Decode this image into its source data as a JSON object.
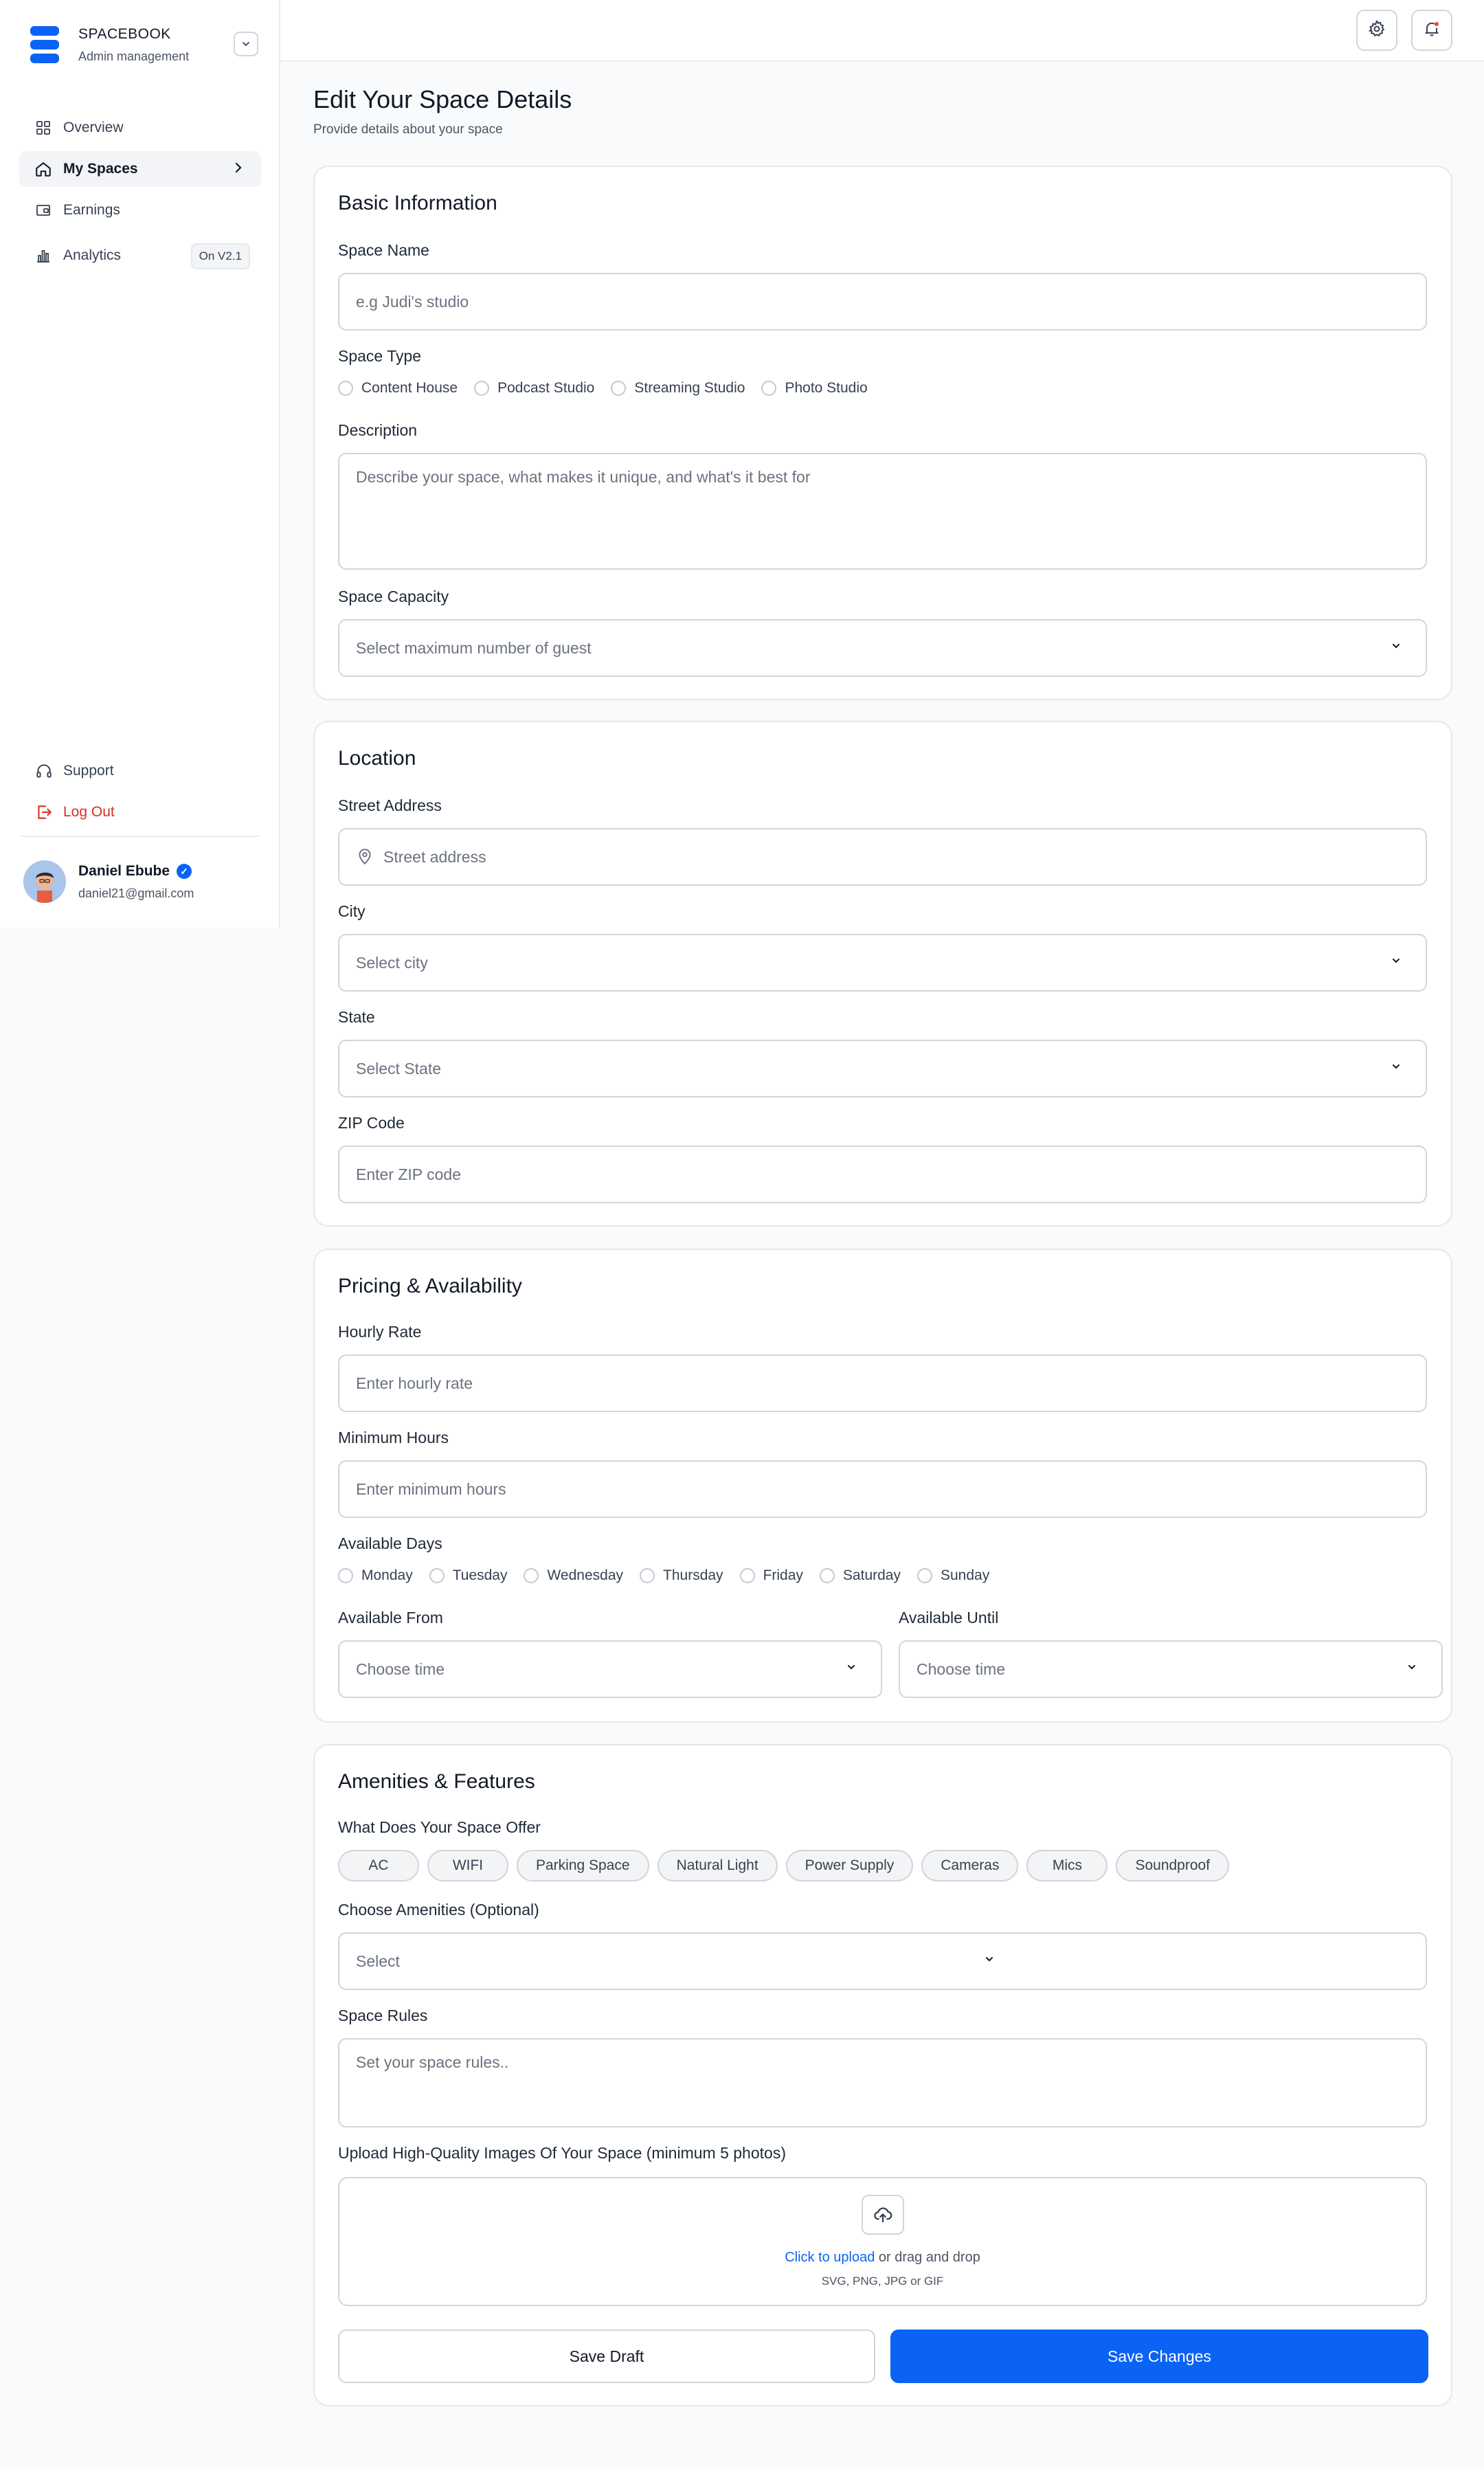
{
  "sidebar": {
    "brand_title": "SPACEBOOK",
    "brand_subtitle": "Admin management",
    "nav": [
      {
        "label": "Overview",
        "icon": "grid-icon"
      },
      {
        "label": "My Spaces",
        "icon": "home-icon",
        "active": true
      },
      {
        "label": "Earnings",
        "icon": "wallet-icon"
      },
      {
        "label": "Analytics",
        "icon": "bar-chart-icon",
        "badge": "On V2.1"
      }
    ],
    "support_label": "Support",
    "logout_label": "Log Out",
    "user": {
      "name": "Daniel Ebube",
      "email": "daniel21@gmail.com"
    }
  },
  "page": {
    "title": "Edit Your Space Details",
    "subtitle": "Provide details about your space"
  },
  "basic": {
    "title": "Basic Information",
    "space_name_label": "Space Name",
    "space_name_placeholder": "e.g Judi's studio",
    "space_type_label": "Space Type",
    "space_types": [
      "Content House",
      "Podcast Studio",
      "Streaming Studio",
      "Photo Studio"
    ],
    "description_label": "Description",
    "description_placeholder": "Describe your space, what makes it unique, and what's it best for",
    "capacity_label": "Space Capacity",
    "capacity_placeholder": "Select maximum number of guest"
  },
  "location": {
    "title": "Location",
    "street_label": "Street Address",
    "street_placeholder": "Street address",
    "city_label": "City",
    "city_placeholder": "Select city",
    "state_label": "State",
    "state_placeholder": "Select State",
    "zip_label": "ZIP Code",
    "zip_placeholder": "Enter ZIP code"
  },
  "pricing": {
    "title": "Pricing & Availability",
    "hourly_label": "Hourly Rate",
    "hourly_placeholder": "Enter hourly rate",
    "min_hours_label": "Minimum Hours",
    "min_hours_placeholder": "Enter minimum hours",
    "days_label": "Available Days",
    "days": [
      "Monday",
      "Tuesday",
      "Wednesday",
      "Thursday",
      "Friday",
      "Saturday",
      "Sunday"
    ],
    "from_label": "Available From",
    "from_placeholder": "Choose time",
    "until_label": "Available Until",
    "until_placeholder": "Choose time"
  },
  "amenities": {
    "title": "Amenities & Features",
    "offer_label": "What Does Your Space Offer",
    "offers": [
      "AC",
      "WIFI",
      "Parking Space",
      "Natural Light",
      "Power Supply",
      "Cameras",
      "Mics",
      "Soundproof"
    ],
    "choose_label": "Choose Amenities (Optional)",
    "choose_placeholder": "Select",
    "rules_label": "Space Rules",
    "rules_placeholder": "Set your space rules..",
    "upload_label": "Upload High-Quality Images Of Your Space (minimum 5 photos)",
    "upload_link": "Click to upload",
    "upload_text": " or drag and drop",
    "upload_hint": "SVG, PNG, JPG or GIF",
    "save_draft": "Save Draft",
    "save_changes": "Save Changes"
  },
  "colors": {
    "accent": "#0b63f6",
    "danger": "#d92d20"
  }
}
